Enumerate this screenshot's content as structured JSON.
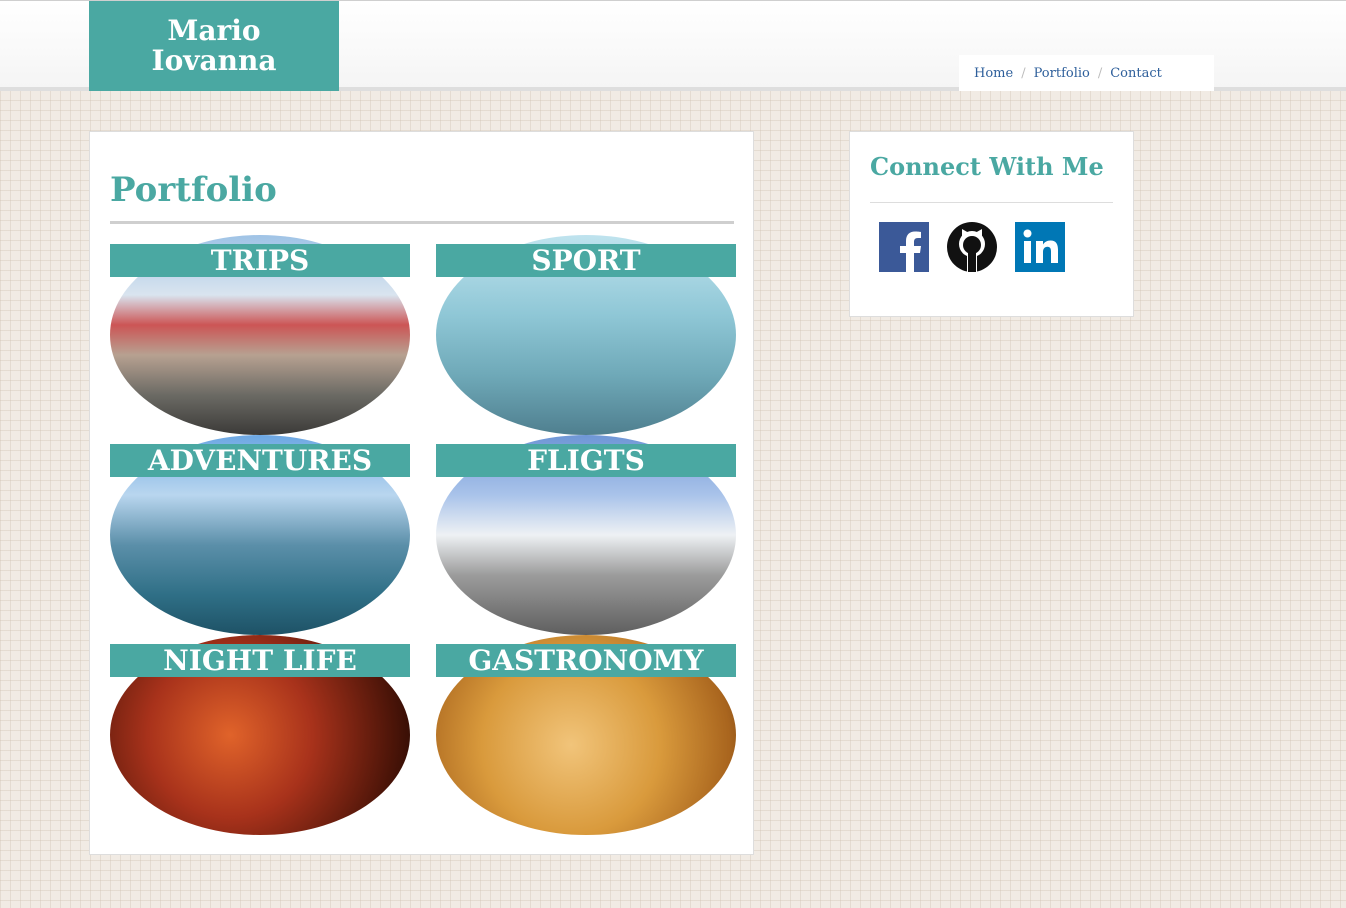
{
  "header": {
    "brand_line1": "Mario",
    "brand_line2": "Iovanna",
    "brand_color": "#4aa8a2",
    "nav": [
      {
        "label": "Home"
      },
      {
        "label": "Portfolio"
      },
      {
        "label": "Contact"
      }
    ]
  },
  "portfolio": {
    "title": "Portfolio",
    "tiles": [
      {
        "label": "TRIPS"
      },
      {
        "label": "SPORT"
      },
      {
        "label": "ADVENTURES"
      },
      {
        "label": "FLIGTS"
      },
      {
        "label": "NIGHT LIFE"
      },
      {
        "label": "GASTRONOMY"
      }
    ]
  },
  "sidebar": {
    "title": "Connect With Me",
    "social": [
      {
        "icon": "facebook-icon",
        "color": "#3b5998"
      },
      {
        "icon": "github-icon",
        "color": "#111111"
      },
      {
        "icon": "linkedin-icon",
        "color": "#0077b5"
      }
    ]
  }
}
